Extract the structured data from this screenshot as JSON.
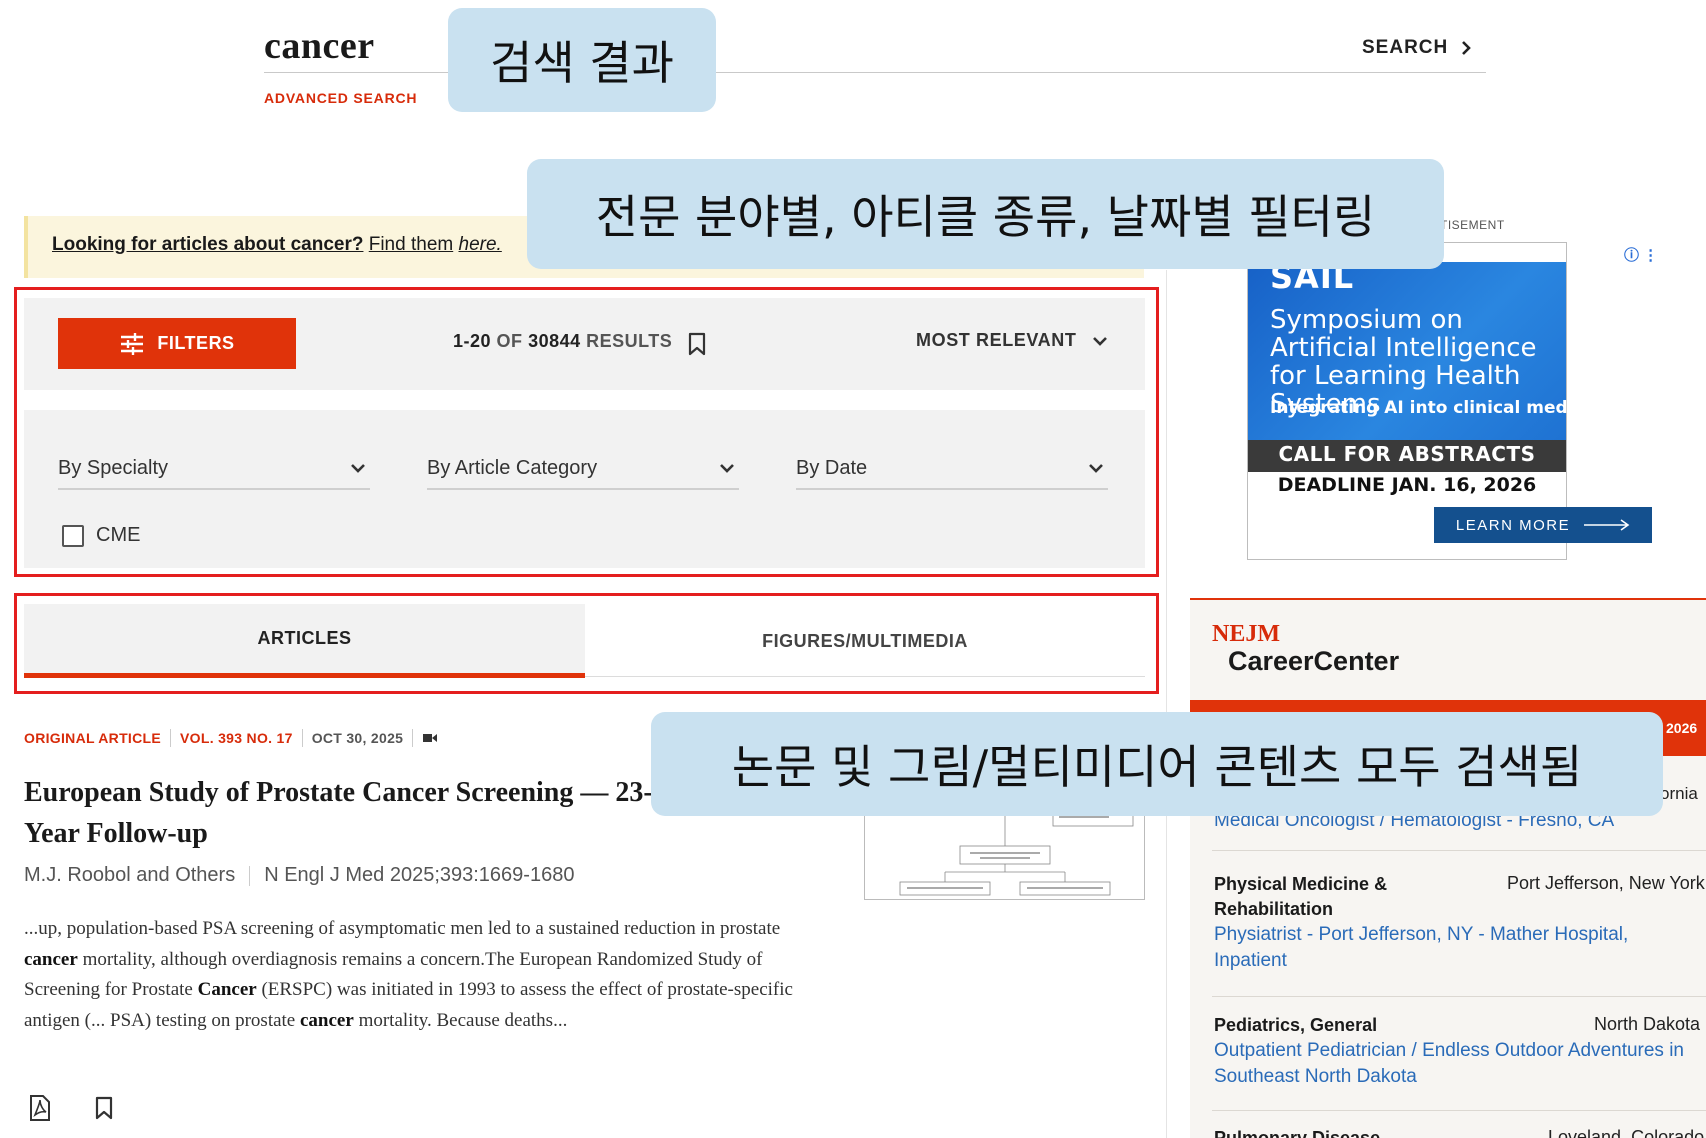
{
  "header": {
    "query": "cancer",
    "advanced_search": "ADVANCED SEARCH",
    "search_label": "SEARCH"
  },
  "callouts": {
    "search_results": "검색 결과",
    "filtering": "전문 분야별, 아티클 종류, 날짜별 필터링",
    "content_types": "논문 및 그림/멀티미디어 콘텐츠 모두 검색됨"
  },
  "notice": {
    "bold_text": "Looking for articles about cancer?",
    "link_text": "Find them",
    "link_italic": "here."
  },
  "filters": {
    "button_label": "FILTERS",
    "results": {
      "range": "1-20",
      "of": "OF",
      "total": "30844",
      "suffix": "RESULTS"
    },
    "sort_label": "MOST RELEVANT",
    "dropdowns": [
      "By Specialty",
      "By Article Category",
      "By Date"
    ],
    "cme_label": "CME"
  },
  "tabs": {
    "articles": "ARTICLES",
    "figures": "FIGURES/MULTIMEDIA"
  },
  "article": {
    "category": "ORIGINAL ARTICLE",
    "volume": "VOL. 393 NO. 17",
    "date": "OCT 30, 2025",
    "title": "European Study of Prostate Cancer Screening — 23-Year Follow-up",
    "authors": "M.J. Roobol and Others",
    "citation": "N Engl J Med 2025;393:1669-1680",
    "snippet_parts": {
      "p1": "...up, population-based PSA screening of asymptomatic men led to a sustained reduction in prostate ",
      "k1": "cancer",
      "p2": " mortality, although overdiagnosis remains a concern.The European Randomized Study of Screening for Prostate ",
      "k2": "Cancer",
      "p3": " (ERSPC) was initiated in 1993 to assess the effect of prostate-specific antigen (... PSA) testing on prostate ",
      "k3": "cancer",
      "p4": " mortality. Because deaths..."
    }
  },
  "ad": {
    "label": "TISEMENT",
    "logo": "SAIL",
    "headline": "Symposium on Artificial Intelligence for Learning Health Systems",
    "subline": "Integrating AI into clinical medicine",
    "cfa": "CALL FOR ABSTRACTS",
    "deadline": "DEADLINE JAN. 16, 2026",
    "cta": "LEARN MORE"
  },
  "career": {
    "logo_top": "NEJM",
    "logo_main": "CareerCenter",
    "bar_year": "2026",
    "jobs": [
      {
        "specialty": "",
        "location": "ornia",
        "title": "Medical Oncologist / Hematologist - Fresno, CA"
      },
      {
        "specialty": "Physical Medicine & Rehabilitation",
        "location": "Port Jefferson, New York",
        "title": "Physiatrist - Port Jefferson, NY - Mather Hospital, Inpatient"
      },
      {
        "specialty": "Pediatrics, General",
        "location": "North Dakota",
        "title": "Outpatient Pediatrician / Endless Outdoor Adventures in Southeast North Dakota"
      },
      {
        "specialty": "Pulmonary Disease",
        "location": "Loveland, Colorado",
        "title": ""
      }
    ]
  },
  "colors": {
    "accent": "#e0330a",
    "highlight_box": "#e41e1e",
    "callout_bg": "#c9e1f0",
    "link_blue": "#2a6bb8",
    "notice_bg": "#fbf5dd"
  }
}
